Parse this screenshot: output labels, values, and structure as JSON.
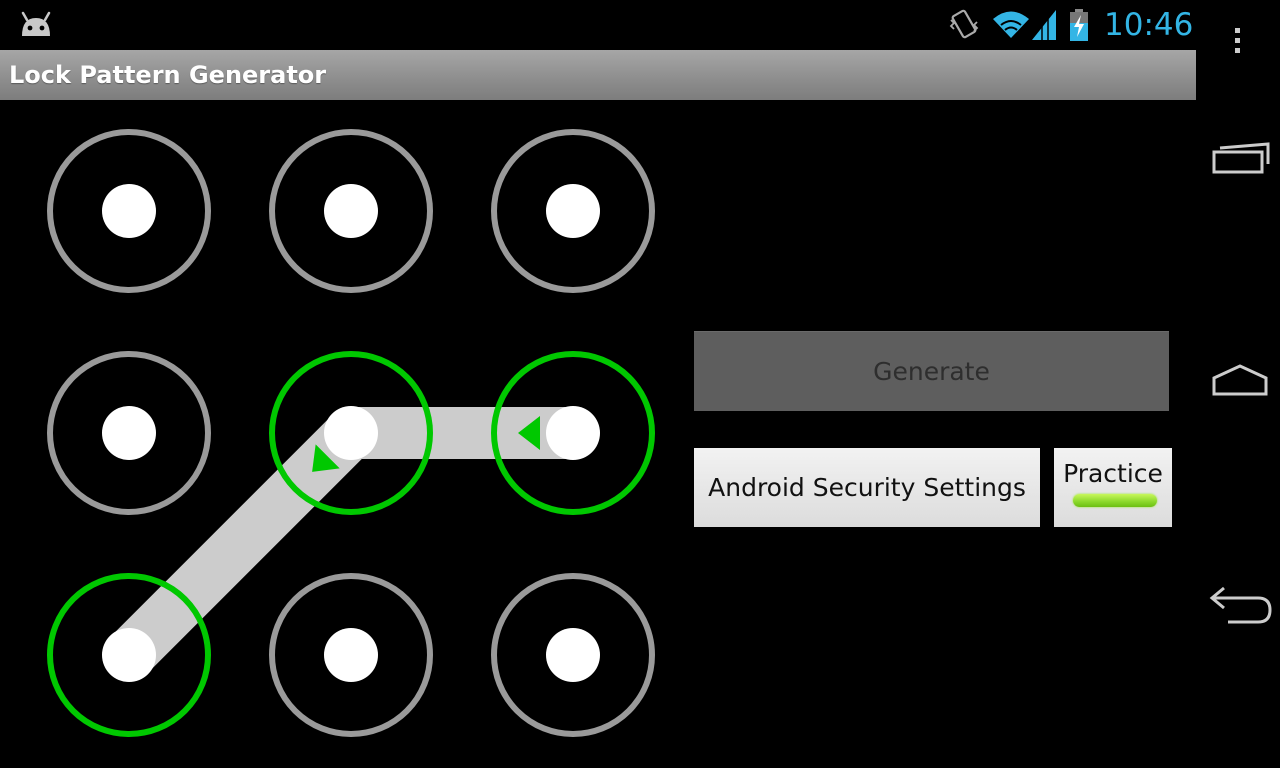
{
  "status_bar": {
    "time": "10:46",
    "icons": [
      "android-icon",
      "vibrate-icon",
      "wifi-icon",
      "signal-icon",
      "battery-charging-icon"
    ],
    "clock_color": "#33b5e5"
  },
  "action_bar": {
    "title": "Lock Pattern Generator"
  },
  "pattern": {
    "grid_size": 3,
    "selected_sequence": [
      6,
      4,
      5
    ],
    "selected_color": "#00c800",
    "unselected_ring_color": "#9a9a9a",
    "path_color": "#cccccc",
    "dot_color": "#ffffff"
  },
  "buttons": {
    "generate_label": "Generate",
    "security_settings_label": "Android Security Settings",
    "practice_label": "Practice",
    "practice_indicator_color": "#8ad82a"
  },
  "nav_bar": {
    "icons": [
      "menu-icon",
      "recent-apps-icon",
      "home-icon",
      "back-icon"
    ]
  }
}
